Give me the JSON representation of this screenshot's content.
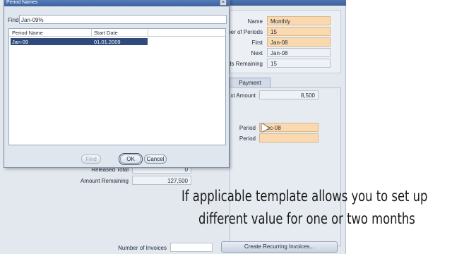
{
  "dialog": {
    "title": "Period Names",
    "close_glyph": "×",
    "find_label": "Find",
    "find_value": "Jan-09%",
    "columns": [
      "Period Name",
      "Start Date"
    ],
    "rows": [
      {
        "period_name": "Jan-09",
        "start_date": "01.01.2009"
      }
    ],
    "buttons": {
      "find": "Find",
      "ok": "OK",
      "cancel": "Cancel"
    }
  },
  "form": {
    "name_label": "Name",
    "name_value": "Monthly",
    "num_periods_label": "ber of Periods",
    "num_periods_value": "15",
    "first_label": "First",
    "first_value": "Jan-08",
    "next_label": "Next",
    "next_value": "Jan-08",
    "remaining_label": "ds Remaining",
    "remaining_value": "15"
  },
  "tabs": {
    "payment": "Payment"
  },
  "payment": {
    "amount_label": "xt Amount",
    "amount_value": "8,500",
    "period1_label": "Period",
    "period1_value": "Dec-08",
    "period2_label": "Period",
    "period2_value": ""
  },
  "summary": {
    "released_total_label": "Released Total",
    "released_total_value": "0",
    "amount_remaining_label": "Amount Remaining",
    "amount_remaining_value": "127,500",
    "num_invoices_label": "Number of Invoices",
    "num_invoices_value": "",
    "create_button": "Create Recurring Invoices..."
  },
  "caption": {
    "line1": "If applicable template allows you to set up",
    "line2": "different value for one or two months"
  },
  "icons": {
    "close": "close-icon",
    "cursor": "mouse-pointer-icon"
  },
  "colors": {
    "required_field": "#fbd9ae",
    "selected_row": "#2f4b7d",
    "title_bar": "#3e62a0"
  }
}
